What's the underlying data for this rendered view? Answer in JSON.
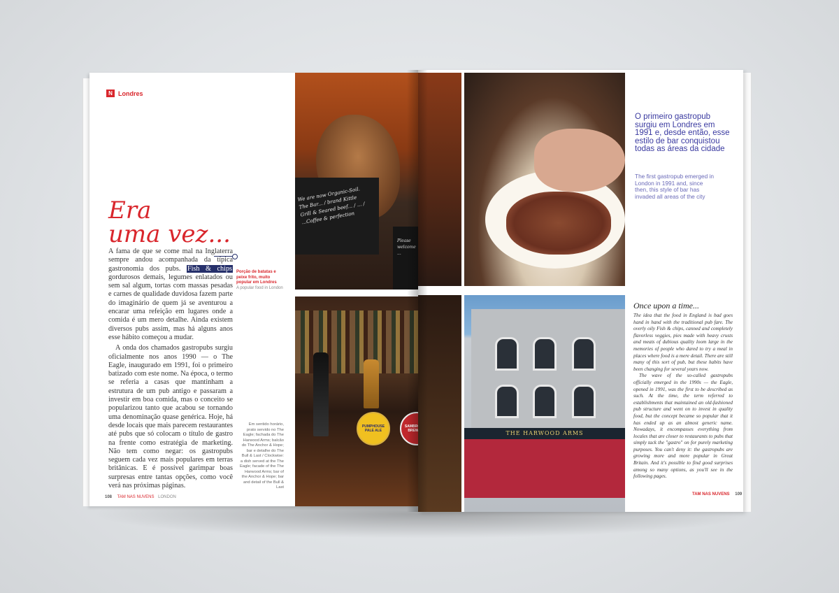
{
  "left_page": {
    "section": {
      "icon": "magazine-logo-icon",
      "label": "Londres"
    },
    "headline_line1": "Era",
    "headline_line2": "uma vez...",
    "paragraph1_before": "A fama de que se come mal na Inglaterra sempre andou acompanhada da típica gastronomia dos pubs. ",
    "paragraph1_highlight": "Fish & chips",
    "paragraph1_after": " gordurosos demais, legumes enlatados ou sem sal algum, tortas com massas pesadas e carnes de qualidade duvidosa fazem parte do imaginário de quem já se aventurou a encarar uma refeição em lugares onde a comida é um mero detalhe. Ainda existem diversos pubs assim, mas há alguns anos esse hábito começou a mudar.",
    "paragraph2": "A onda dos chamados gastropubs surgiu oficialmente nos anos 1990 — o The Eagle, inaugurado em 1991, foi o primeiro batizado com este nome. Na época, o termo se referia a casas que mantinham a estrutura de um pub antigo e passaram a investir em boa comida, mas o conceito se popularizou tanto que acabou se tornando uma denominação quase genérica. Hoje, há desde locais que mais parecem restaurantes até pubs que só colocam o título de gastro na frente como estratégia de marketing. Não tem como negar: os gastropubs seguem cada vez mais populares em terras britânicas. E é possível garimpar boas surpresas entre tantas opções, como você verá nas próximas páginas.",
    "callout_pt": "Porção de batatas e peixe frito, muito popular em Londres",
    "callout_en": "A popular food in London",
    "photo_caption": "Em sentido horário, prato servido no The Eagle; fachada do The Harwood Arms; balcão do The Anchor & Hope; bar e detalhe do The Bull & Last / Clockwise: a dish served at the The Eagle; facade of the The Harwood Arms; bar of the Anchor & Hope; bar and detail of the Bull & Last",
    "folio_page": "108",
    "folio_publication": "TAM NAS NUVENS",
    "folio_section": "LONDON"
  },
  "photos": {
    "bull_board_text": "We are now Organic-Soil. The Bar... / brand Kittle Grill & Seared beef... / ... / ...Coffee & perfection",
    "bull_board2_text": "Please welcome ...",
    "tap_clip1": "PUMPHOUSE PALE ALE",
    "tap_clip2": "SAMBROOK'S BREWERY",
    "pub_sign": "THE HARWOOD ARMS"
  },
  "right_page": {
    "pull_quote_pt": "O primeiro gastropub surgiu em Londres em 1991 e, desde então, esse estilo de bar conquistou todas as áreas da cidade",
    "pull_quote_en": "The first gastropub emerged in London in 1991 and, since then, this style of bar has invaded all areas of the city",
    "en_title": "Once upon a time...",
    "en_paragraph1": "The idea that the food in England is bad goes hand in hand with the traditional pub fare. The overly oily Fish & chips, canned and completely flavorless veggies, pies made with heavy crusts and meats of dubious quality loom large in the memories of people who dared to try a meal in places where food is a mere detail. There are still many of this sort of pub, but these habits have been changing for several years now.",
    "en_paragraph2": "The wave of the so-called gastropubs officially emerged in the 1990s — the Eagle, opened in 1991, was the first to be described as such. At the time, the term referred to establishments that maintained an old-fashioned pub structure and went on to invest in quality food, but the concept became so popular that it has ended up as an almost generic name. Nowadays, it encompasses everything from locales that are closer to restaurants to pubs that simply tack the \"gastro\" on for purely marketing purposes. You can't deny it: the gastropubs are growing more and more popular in Great Britain. And it's possible to find good surprises among so many options, as you'll see in the following pages.",
    "folio_publication": "TAM NAS NUVENS",
    "folio_page": "109"
  }
}
